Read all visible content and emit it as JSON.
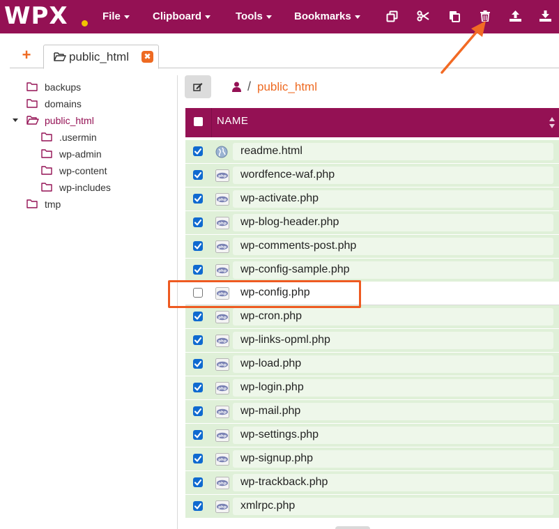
{
  "brand": {
    "logo_text": "WPX",
    "accent_color": "#941154",
    "highlight_color": "#ee6a22",
    "logo_dot_color": "#f2c300"
  },
  "menu": {
    "file": "File",
    "clipboard": "Clipboard",
    "tools": "Tools",
    "bookmarks": "Bookmarks"
  },
  "toolbar_icons": [
    "copy-icon",
    "cut-icon",
    "paste-icon",
    "delete-icon",
    "upload-icon",
    "download-icon"
  ],
  "tabs": {
    "add_label": "+",
    "active_label": "public_html",
    "close_label": "✖"
  },
  "tree": {
    "items": [
      {
        "label": "backups",
        "icon": "folder-icon"
      },
      {
        "label": "domains",
        "icon": "folder-icon"
      },
      {
        "label": "public_html",
        "icon": "folder-open-icon",
        "expanded": true,
        "active": true
      },
      {
        "label": ".usermin",
        "icon": "folder-icon"
      },
      {
        "label": "wp-admin",
        "icon": "folder-icon"
      },
      {
        "label": "wp-content",
        "icon": "folder-icon"
      },
      {
        "label": "wp-includes",
        "icon": "folder-icon"
      },
      {
        "label": "tmp",
        "icon": "folder-icon"
      }
    ]
  },
  "path": {
    "separator": "/",
    "current": "public_html"
  },
  "table": {
    "name_header": "NAME",
    "rows": [
      {
        "name": "readme.html",
        "icon": "html-file-icon",
        "checked": true
      },
      {
        "name": "wordfence-waf.php",
        "icon": "php-file-icon",
        "checked": true
      },
      {
        "name": "wp-activate.php",
        "icon": "php-file-icon",
        "checked": true
      },
      {
        "name": "wp-blog-header.php",
        "icon": "php-file-icon",
        "checked": true
      },
      {
        "name": "wp-comments-post.php",
        "icon": "php-file-icon",
        "checked": true
      },
      {
        "name": "wp-config-sample.php",
        "icon": "php-file-icon",
        "checked": true
      },
      {
        "name": "wp-config.php",
        "icon": "php-file-icon",
        "checked": false
      },
      {
        "name": "wp-cron.php",
        "icon": "php-file-icon",
        "checked": true
      },
      {
        "name": "wp-links-opml.php",
        "icon": "php-file-icon",
        "checked": true
      },
      {
        "name": "wp-load.php",
        "icon": "php-file-icon",
        "checked": true
      },
      {
        "name": "wp-login.php",
        "icon": "php-file-icon",
        "checked": true
      },
      {
        "name": "wp-mail.php",
        "icon": "php-file-icon",
        "checked": true
      },
      {
        "name": "wp-settings.php",
        "icon": "php-file-icon",
        "checked": true
      },
      {
        "name": "wp-signup.php",
        "icon": "php-file-icon",
        "checked": true
      },
      {
        "name": "wp-trackback.php",
        "icon": "php-file-icon",
        "checked": true
      },
      {
        "name": "xmlrpc.php",
        "icon": "php-file-icon",
        "checked": true
      }
    ]
  }
}
